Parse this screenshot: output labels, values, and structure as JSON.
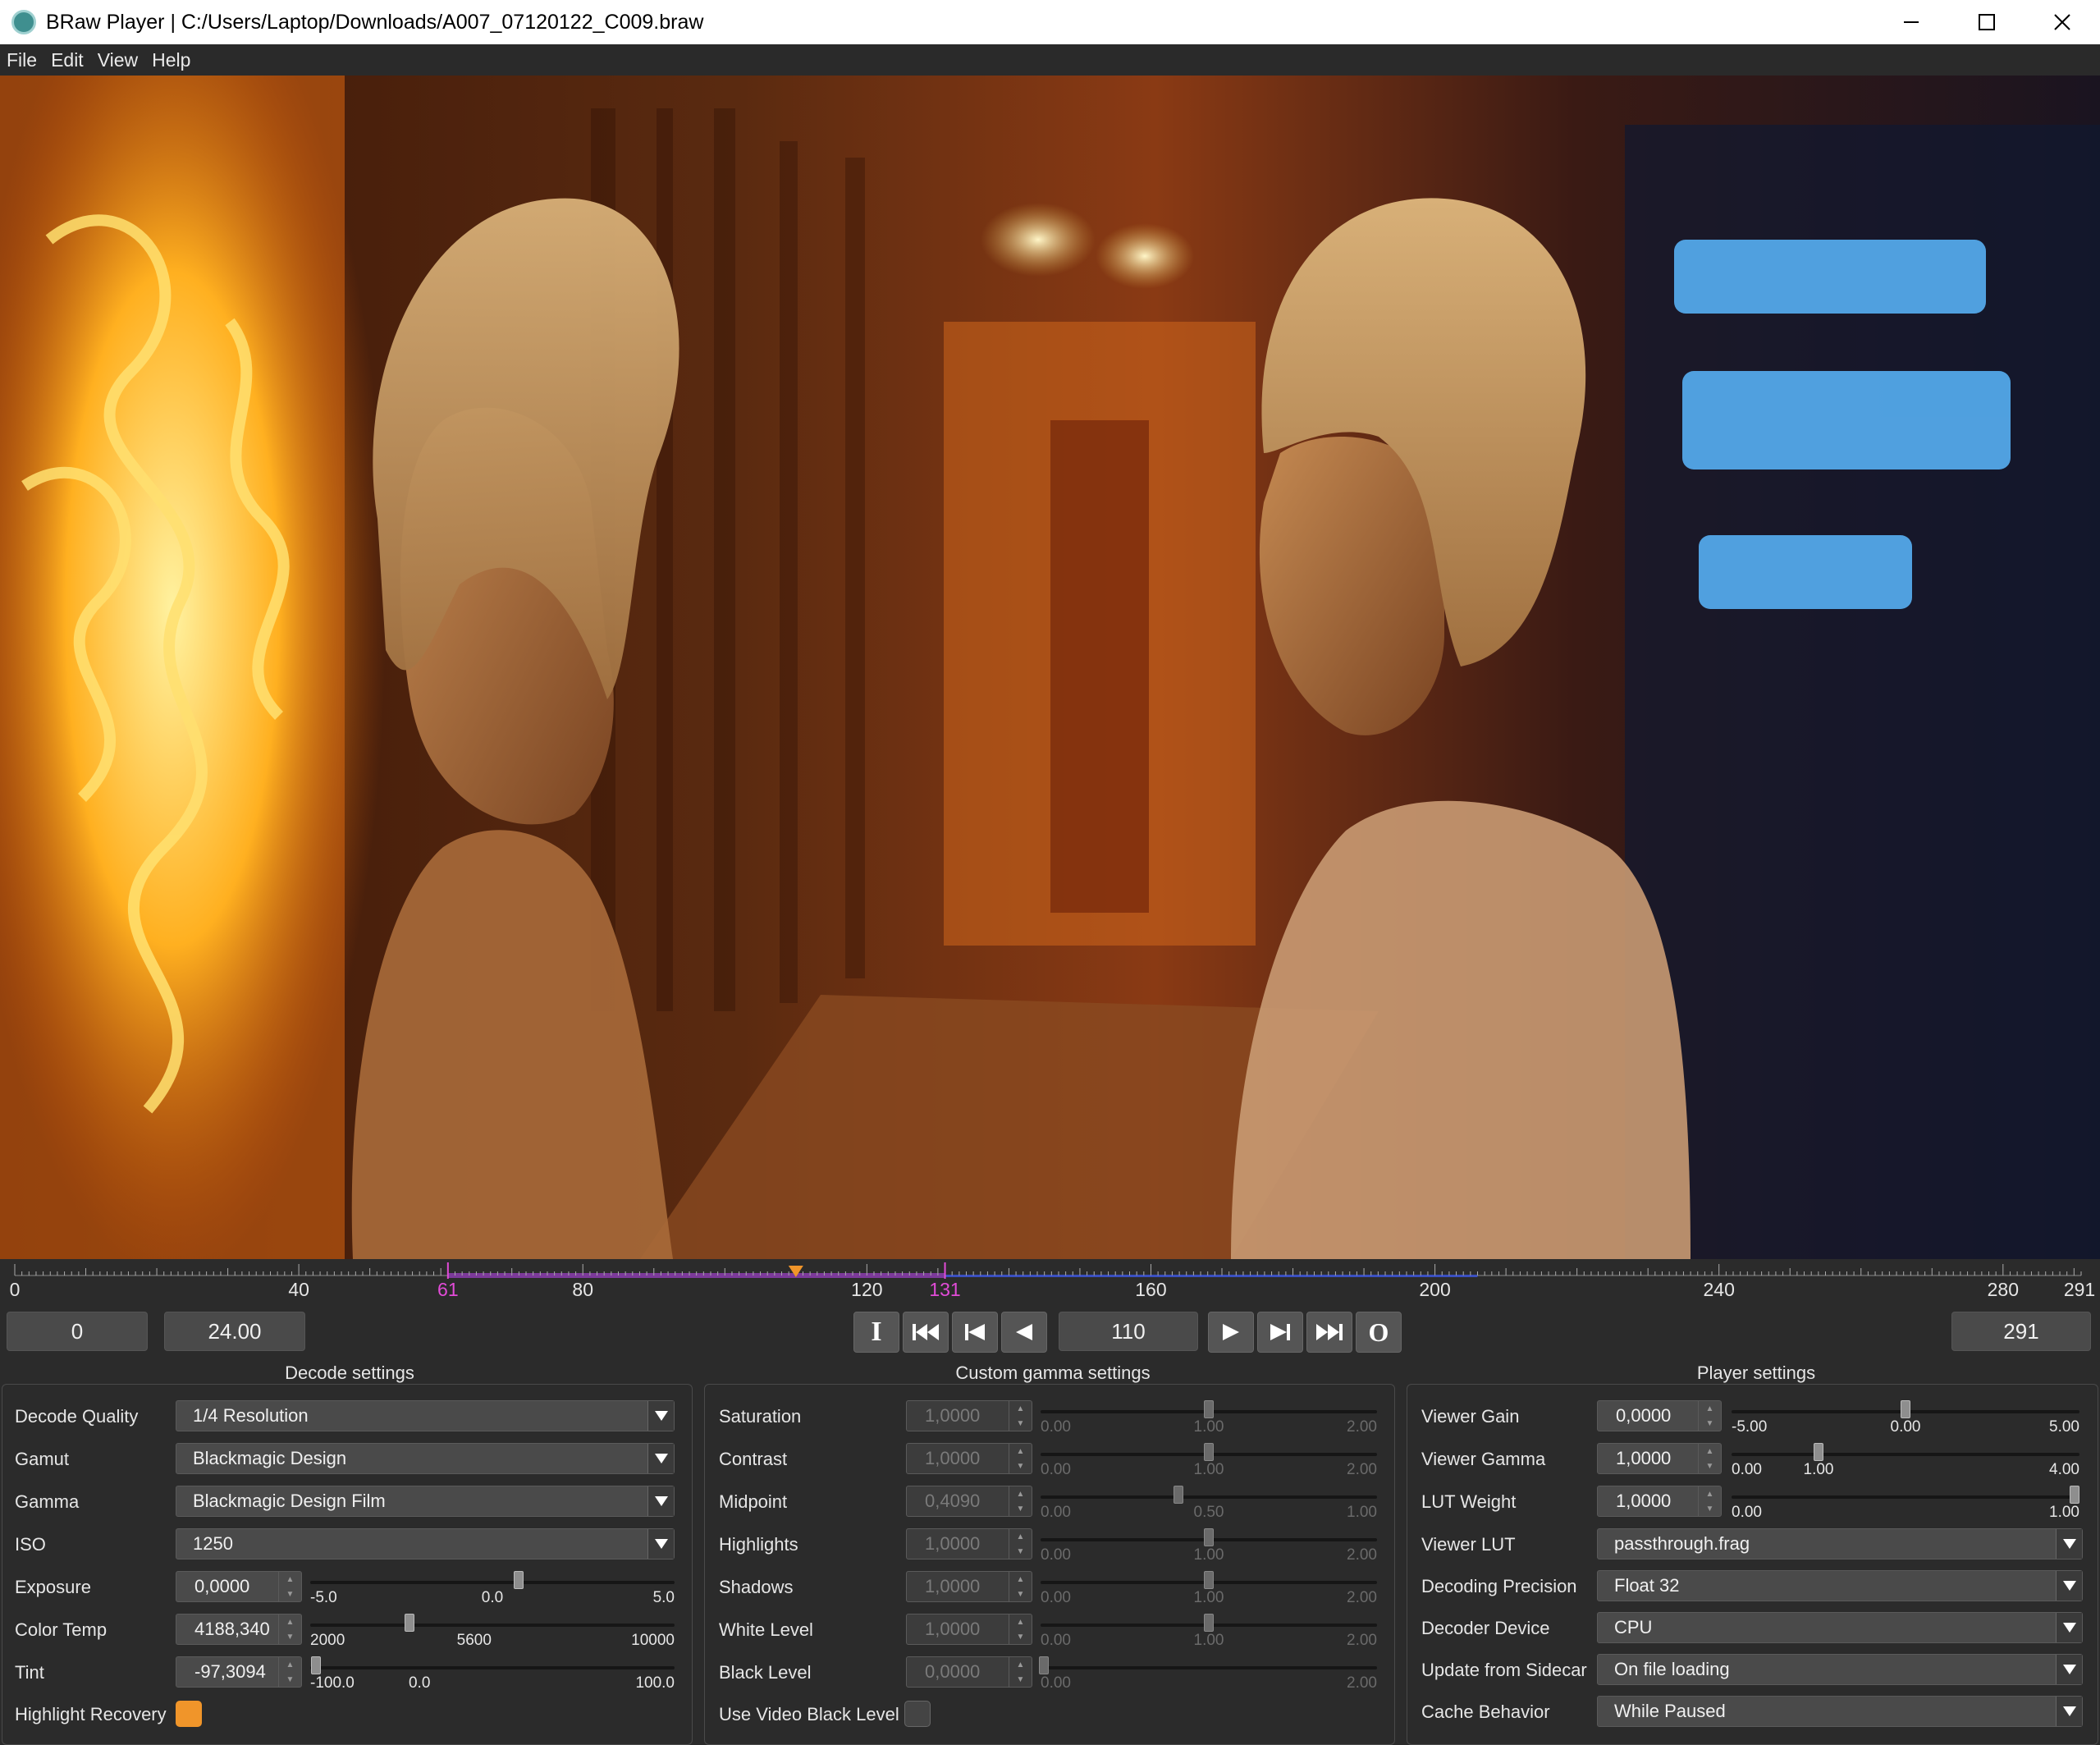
{
  "window": {
    "title": "BRaw Player | C:/Users/Laptop/Downloads/A007_07120122_C009.braw"
  },
  "menu": [
    "File",
    "Edit",
    "View",
    "Help"
  ],
  "timeline": {
    "in_point": 61,
    "out_point": 131,
    "playhead": 110,
    "labels": [
      "0",
      "40",
      "61",
      "80",
      "120",
      "131",
      "160",
      "200",
      "240",
      "280",
      "291"
    ]
  },
  "transport": {
    "start_frame": "0",
    "frame_rate": "24.00",
    "current_frame": "110",
    "end_frame": "291",
    "in_button": "I",
    "out_button": "O"
  },
  "decode": {
    "title": "Decode settings",
    "rows": [
      {
        "label": "Decode Quality",
        "value": "1/4 Resolution"
      },
      {
        "label": "Gamut",
        "value": "Blackmagic Design"
      },
      {
        "label": "Gamma",
        "value": "Blackmagic Design Film"
      },
      {
        "label": "ISO",
        "value": "1250"
      }
    ],
    "exposure": {
      "label": "Exposure",
      "value": "0,0000",
      "min": "-5.0",
      "mid": "0.0",
      "max": "5.0"
    },
    "color_temp": {
      "label": "Color Temp",
      "value": "4188,340",
      "min": "2000",
      "mid": "5600",
      "max": "10000"
    },
    "tint": {
      "label": "Tint",
      "value": "-97,3094",
      "min": "-100.0",
      "mid": "0.0",
      "max": "100.0"
    },
    "highlight_recovery": {
      "label": "Highlight Recovery",
      "checked": true
    }
  },
  "gamma": {
    "title": "Custom gamma settings",
    "rows": [
      {
        "label": "Saturation",
        "value": "1,0000",
        "min": "0.00",
        "mid": "1.00",
        "max": "2.00"
      },
      {
        "label": "Contrast",
        "value": "1,0000",
        "min": "0.00",
        "mid": "1.00",
        "max": "2.00"
      },
      {
        "label": "Midpoint",
        "value": "0,4090",
        "min": "0.00",
        "mid": "0.50",
        "max": "1.00"
      },
      {
        "label": "Highlights",
        "value": "1,0000",
        "min": "0.00",
        "mid": "1.00",
        "max": "2.00"
      },
      {
        "label": "Shadows",
        "value": "1,0000",
        "min": "0.00",
        "mid": "1.00",
        "max": "2.00"
      },
      {
        "label": "White Level",
        "value": "1,0000",
        "min": "0.00",
        "mid": "1.00",
        "max": "2.00"
      },
      {
        "label": "Black Level",
        "value": "0,0000",
        "min": "0.00",
        "mid": "",
        "max": "2.00"
      }
    ],
    "use_video_black_level": {
      "label": "Use Video Black Level",
      "checked": false
    }
  },
  "player": {
    "title": "Player settings",
    "viewer_gain": {
      "label": "Viewer Gain",
      "value": "0,0000",
      "min": "-5.00",
      "mid": "0.00",
      "max": "5.00"
    },
    "viewer_gamma": {
      "label": "Viewer Gamma",
      "value": "1,0000",
      "min": "0.00",
      "mid": "1.00",
      "max": "4.00"
    },
    "lut_weight": {
      "label": "LUT Weight",
      "value": "1,0000",
      "min": "0.00",
      "mid": "",
      "max": "1.00"
    },
    "rows": [
      {
        "label": "Viewer LUT",
        "value": "passthrough.frag"
      },
      {
        "label": "Decoding Precision",
        "value": "Float 32"
      },
      {
        "label": "Decoder Device",
        "value": "CPU"
      },
      {
        "label": "Update from Sidecar",
        "value": "On file loading"
      },
      {
        "label": "Cache Behavior",
        "value": "While Paused"
      }
    ]
  },
  "colors": {
    "accent": "#f0952a",
    "marker": "#e24bd8",
    "in_out_range": "#7c3a9a",
    "cache_range": "#3a4fc0"
  }
}
